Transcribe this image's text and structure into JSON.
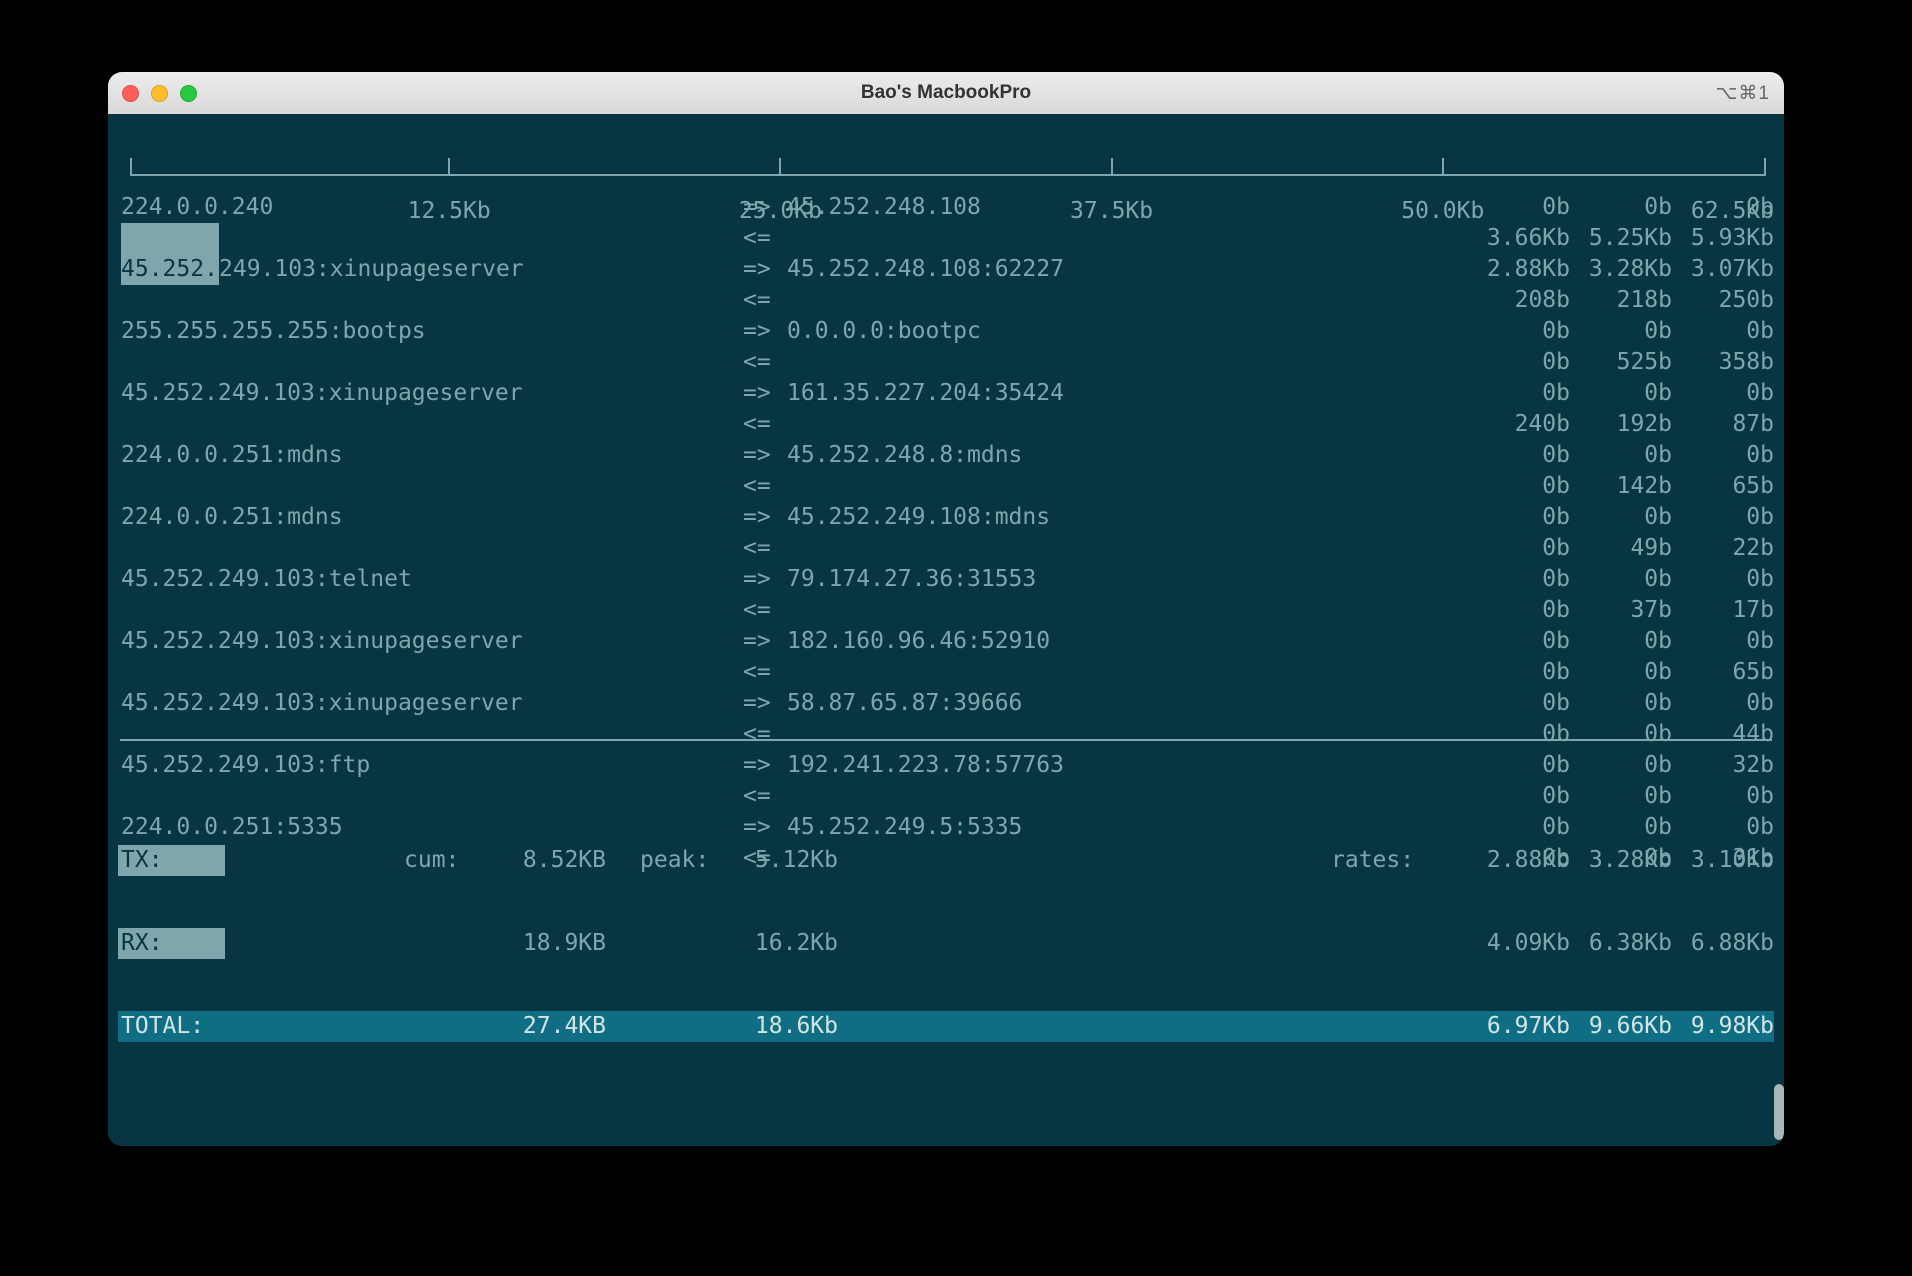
{
  "window": {
    "title": "Bao's MacbookPro",
    "shortcut": "⌥⌘1"
  },
  "scale": {
    "labels": [
      "12.5Kb",
      "25.0Kb",
      "37.5Kb",
      "50.0Kb",
      "62.5Kb"
    ],
    "positions_pct": [
      20,
      40,
      60,
      80,
      100
    ]
  },
  "rows": [
    {
      "left": "224.0.0.240",
      "arrow": "=>",
      "right": "45.252.248.108",
      "a": "0b",
      "b": "0b",
      "c": "0b",
      "sel_left_chars": 0
    },
    {
      "left": "",
      "arrow": "<=",
      "right": "",
      "a": "3.66Kb",
      "b": "5.25Kb",
      "c": "5.93Kb",
      "sel_left_chars": 7
    },
    {
      "left": "45.252.249.103:xinupageserver",
      "arrow": "=>",
      "right": "45.252.248.108:62227",
      "a": "2.88Kb",
      "b": "3.28Kb",
      "c": "3.07Kb",
      "sel_left_chars": 7
    },
    {
      "left": "",
      "arrow": "<=",
      "right": "",
      "a": "208b",
      "b": "218b",
      "c": "250b",
      "sel_left_chars": 0
    },
    {
      "left": "255.255.255.255:bootps",
      "arrow": "=>",
      "right": "0.0.0.0:bootpc",
      "a": "0b",
      "b": "0b",
      "c": "0b",
      "sel_left_chars": 0
    },
    {
      "left": "",
      "arrow": "<=",
      "right": "",
      "a": "0b",
      "b": "525b",
      "c": "358b",
      "sel_left_chars": 0
    },
    {
      "left": "45.252.249.103:xinupageserver",
      "arrow": "=>",
      "right": "161.35.227.204:35424",
      "a": "0b",
      "b": "0b",
      "c": "0b",
      "sel_left_chars": 0
    },
    {
      "left": "",
      "arrow": "<=",
      "right": "",
      "a": "240b",
      "b": "192b",
      "c": "87b",
      "sel_left_chars": 0
    },
    {
      "left": "224.0.0.251:mdns",
      "arrow": "=>",
      "right": "45.252.248.8:mdns",
      "a": "0b",
      "b": "0b",
      "c": "0b",
      "sel_left_chars": 0
    },
    {
      "left": "",
      "arrow": "<=",
      "right": "",
      "a": "0b",
      "b": "142b",
      "c": "65b",
      "sel_left_chars": 0
    },
    {
      "left": "224.0.0.251:mdns",
      "arrow": "=>",
      "right": "45.252.249.108:mdns",
      "a": "0b",
      "b": "0b",
      "c": "0b",
      "sel_left_chars": 0
    },
    {
      "left": "",
      "arrow": "<=",
      "right": "",
      "a": "0b",
      "b": "49b",
      "c": "22b",
      "sel_left_chars": 0
    },
    {
      "left": "45.252.249.103:telnet",
      "arrow": "=>",
      "right": "79.174.27.36:31553",
      "a": "0b",
      "b": "0b",
      "c": "0b",
      "sel_left_chars": 0
    },
    {
      "left": "",
      "arrow": "<=",
      "right": "",
      "a": "0b",
      "b": "37b",
      "c": "17b",
      "sel_left_chars": 0
    },
    {
      "left": "45.252.249.103:xinupageserver",
      "arrow": "=>",
      "right": "182.160.96.46:52910",
      "a": "0b",
      "b": "0b",
      "c": "0b",
      "sel_left_chars": 0
    },
    {
      "left": "",
      "arrow": "<=",
      "right": "",
      "a": "0b",
      "b": "0b",
      "c": "65b",
      "sel_left_chars": 0
    },
    {
      "left": "45.252.249.103:xinupageserver",
      "arrow": "=>",
      "right": "58.87.65.87:39666",
      "a": "0b",
      "b": "0b",
      "c": "0b",
      "sel_left_chars": 0
    },
    {
      "left": "",
      "arrow": "<=",
      "right": "",
      "a": "0b",
      "b": "0b",
      "c": "44b",
      "sel_left_chars": 0
    },
    {
      "left": "45.252.249.103:ftp",
      "arrow": "=>",
      "right": "192.241.223.78:57763",
      "a": "0b",
      "b": "0b",
      "c": "32b",
      "sel_left_chars": 0
    },
    {
      "left": "",
      "arrow": "<=",
      "right": "",
      "a": "0b",
      "b": "0b",
      "c": "0b",
      "sel_left_chars": 0
    },
    {
      "left": "224.0.0.251:5335",
      "arrow": "=>",
      "right": "45.252.249.5:5335",
      "a": "0b",
      "b": "0b",
      "c": "0b",
      "sel_left_chars": 0
    },
    {
      "left": "",
      "arrow": "<=",
      "right": "",
      "a": "0b",
      "b": "0b",
      "c": "31b",
      "sel_left_chars": 0
    }
  ],
  "footer": {
    "cum_label": "cum:",
    "peak_label": "peak:",
    "rates_label": "rates:",
    "tx": {
      "label": "TX:",
      "cum": "8.52KB",
      "peak": "5.12Kb",
      "r1": "2.88Kb",
      "r2": "3.28Kb",
      "r3": "3.10Kb"
    },
    "rx": {
      "label": "RX:",
      "cum": "18.9KB",
      "peak": "16.2Kb",
      "r1": "4.09Kb",
      "r2": "6.38Kb",
      "r3": "6.88Kb"
    },
    "total": {
      "label": "TOTAL:",
      "cum": "27.4KB",
      "peak": "18.6Kb",
      "r1": "6.97Kb",
      "r2": "9.66Kb",
      "r3": "9.98Kb"
    }
  }
}
